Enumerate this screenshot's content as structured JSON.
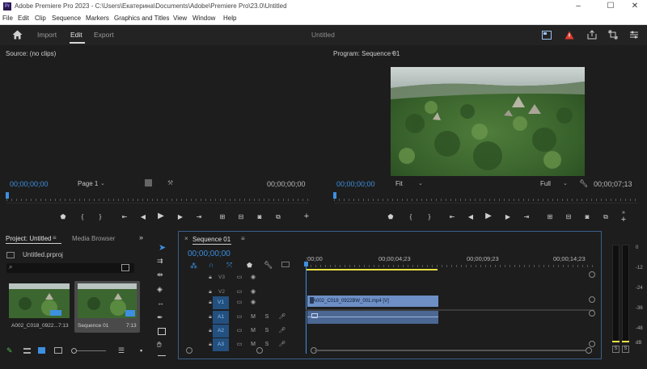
{
  "window": {
    "title": "Adobe Premiere Pro 2023 - C:\\Users\\Екатерина\\Documents\\Adobe\\Premiere Pro\\23.0\\Untitled",
    "app_icon": "Pr",
    "minimize": "–",
    "maximize": "☐",
    "close": "✕"
  },
  "menu": [
    "File",
    "Edit",
    "Clip",
    "Sequence",
    "Markers",
    "Graphics and Titles",
    "View",
    "Window",
    "Help"
  ],
  "header": {
    "tabs": [
      "Import",
      "Edit",
      "Export"
    ],
    "active_tab": "Edit",
    "project_name": "Untitled"
  },
  "source": {
    "title": "Source: (no clips)",
    "timecode_left": "00;00;00;00",
    "page_select": "Page 1",
    "timecode_right": "00;00;00;00"
  },
  "program": {
    "title": "Program: Sequence 01",
    "timecode_left": "00;00;00;00",
    "fit_select": "Fit",
    "quality_select": "Full",
    "timecode_right": "00;00;07;13"
  },
  "project": {
    "tab_active": "Project: Untitled",
    "tab_other": "Media Browser",
    "file_name": "Untitled.prproj",
    "items": [
      {
        "name": "A002_C018_0922...",
        "duration": "7:13"
      },
      {
        "name": "Sequence 01",
        "duration": "7:13"
      }
    ]
  },
  "timeline": {
    "tab": "Sequence 01",
    "timecode": "00;00;00;00",
    "ruler": [
      ":00;00",
      "00;00;04;23",
      "00;00;09;23",
      "00;00;14;23"
    ],
    "tracks": [
      {
        "name": "V3",
        "target": "",
        "kind": "video"
      },
      {
        "name": "V2",
        "target": "",
        "kind": "video"
      },
      {
        "name": "V1",
        "target": "V1",
        "kind": "video"
      },
      {
        "name": "A1",
        "target": "A1",
        "kind": "audio"
      },
      {
        "name": "A2",
        "target": "A2",
        "kind": "audio"
      },
      {
        "name": "A3",
        "target": "A3",
        "kind": "audio"
      }
    ],
    "audio_buttons": {
      "m": "M",
      "s": "S"
    },
    "clip_label": "A002_C018_0922BW_001.mp4 [V]"
  },
  "meters": {
    "scale": [
      "0",
      "-12",
      "-24",
      "-36",
      "-48",
      "dB"
    ],
    "solo_left": "S",
    "solo_right": "S"
  },
  "colors": {
    "accent_blue": "#3d8fe0",
    "timecode_blue": "#3d8fe0",
    "clip_video": "#6d8fc6",
    "clip_audio": "#4b6793",
    "work_area_yellow": "#e8e040",
    "alert_red": "#e03a2f"
  }
}
